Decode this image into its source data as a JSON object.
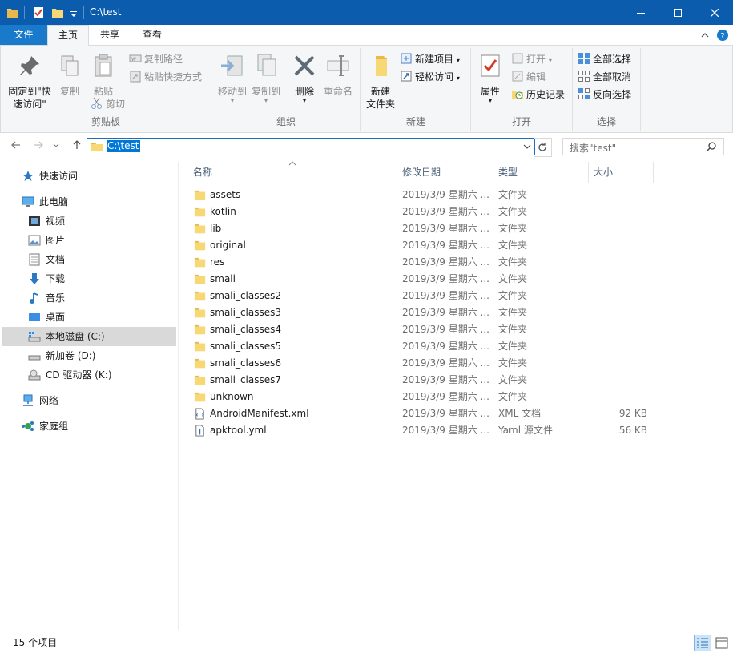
{
  "window": {
    "title": "C:\\test"
  },
  "ribbon_tabs": [
    {
      "label": "文件"
    },
    {
      "label": "主页"
    },
    {
      "label": "共享"
    },
    {
      "label": "查看"
    }
  ],
  "ribbon": {
    "clipboard": {
      "group_label": "剪贴板",
      "pin_label_1": "固定到\"快",
      "pin_label_2": "速访问\"",
      "copy_label": "复制",
      "paste_label": "粘贴",
      "copy_path_label": "复制路径",
      "paste_shortcut_label": "粘贴快捷方式",
      "cut_label": "剪切"
    },
    "organize": {
      "group_label": "组织",
      "move_to_label": "移动到",
      "copy_to_label": "复制到",
      "delete_label": "删除",
      "rename_label": "重命名"
    },
    "new": {
      "group_label": "新建",
      "new_folder_label_1": "新建",
      "new_folder_label_2": "文件夹",
      "new_item_label": "新建项目",
      "easy_access_label": "轻松访问"
    },
    "open": {
      "group_label": "打开",
      "properties_label": "属性",
      "open_label": "打开",
      "edit_label": "编辑",
      "history_label": "历史记录"
    },
    "select": {
      "group_label": "选择",
      "select_all_label": "全部选择",
      "select_none_label": "全部取消",
      "invert_label": "反向选择"
    }
  },
  "address": {
    "path": "C:\\test",
    "search_placeholder": "搜索\"test\""
  },
  "nav": {
    "quick_access": "快速访问",
    "this_pc": "此电脑",
    "videos": "视频",
    "pictures": "图片",
    "documents": "文档",
    "downloads": "下载",
    "music": "音乐",
    "desktop": "桌面",
    "local_disk": "本地磁盘 (C:)",
    "new_volume": "新加卷 (D:)",
    "cd_drive": "CD 驱动器 (K:)",
    "network": "网络",
    "homegroup": "家庭组"
  },
  "columns": {
    "name": "名称",
    "date": "修改日期",
    "type": "类型",
    "size": "大小"
  },
  "files": [
    {
      "name": "assets",
      "date": "2019/3/9 星期六 ...",
      "type": "文件夹",
      "size": "",
      "kind": "folder"
    },
    {
      "name": "kotlin",
      "date": "2019/3/9 星期六 ...",
      "type": "文件夹",
      "size": "",
      "kind": "folder"
    },
    {
      "name": "lib",
      "date": "2019/3/9 星期六 ...",
      "type": "文件夹",
      "size": "",
      "kind": "folder"
    },
    {
      "name": "original",
      "date": "2019/3/9 星期六 ...",
      "type": "文件夹",
      "size": "",
      "kind": "folder"
    },
    {
      "name": "res",
      "date": "2019/3/9 星期六 ...",
      "type": "文件夹",
      "size": "",
      "kind": "folder"
    },
    {
      "name": "smali",
      "date": "2019/3/9 星期六 ...",
      "type": "文件夹",
      "size": "",
      "kind": "folder"
    },
    {
      "name": "smali_classes2",
      "date": "2019/3/9 星期六 ...",
      "type": "文件夹",
      "size": "",
      "kind": "folder"
    },
    {
      "name": "smali_classes3",
      "date": "2019/3/9 星期六 ...",
      "type": "文件夹",
      "size": "",
      "kind": "folder"
    },
    {
      "name": "smali_classes4",
      "date": "2019/3/9 星期六 ...",
      "type": "文件夹",
      "size": "",
      "kind": "folder"
    },
    {
      "name": "smali_classes5",
      "date": "2019/3/9 星期六 ...",
      "type": "文件夹",
      "size": "",
      "kind": "folder"
    },
    {
      "name": "smali_classes6",
      "date": "2019/3/9 星期六 ...",
      "type": "文件夹",
      "size": "",
      "kind": "folder"
    },
    {
      "name": "smali_classes7",
      "date": "2019/3/9 星期六 ...",
      "type": "文件夹",
      "size": "",
      "kind": "folder"
    },
    {
      "name": "unknown",
      "date": "2019/3/9 星期六 ...",
      "type": "文件夹",
      "size": "",
      "kind": "folder"
    },
    {
      "name": "AndroidManifest.xml",
      "date": "2019/3/9 星期六 ...",
      "type": "XML 文档",
      "size": "92 KB",
      "kind": "xml"
    },
    {
      "name": "apktool.yml",
      "date": "2019/3/9 星期六 ...",
      "type": "Yaml 源文件",
      "size": "56 KB",
      "kind": "yml"
    }
  ],
  "status": {
    "item_count": "15 个项目"
  },
  "colors": {
    "titlebar": "#0b5cad",
    "file_tab": "#1979ca",
    "selection": "#0078d7",
    "folder": "#f8d775"
  }
}
